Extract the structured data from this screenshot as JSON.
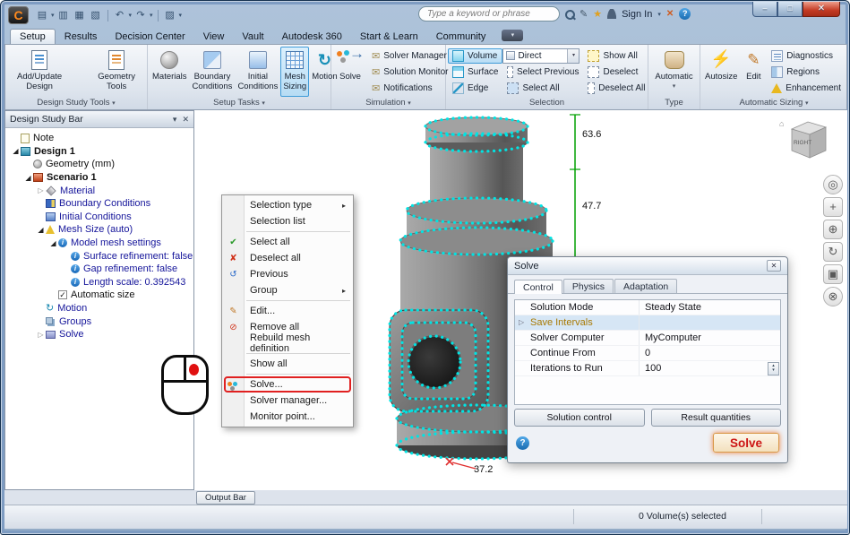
{
  "colors": {
    "accent_blue": "#3f9bd8",
    "selection_cyan": "#00e4e4",
    "solve_red": "#cc1414",
    "highlight_red": "#e02020",
    "dimension_green": "#00a000"
  },
  "titlebar": {
    "search_placeholder": "Type a keyword or phrase",
    "sign_in": "Sign In"
  },
  "tabs": [
    "Setup",
    "Results",
    "Decision Center",
    "View",
    "Vault",
    "Autodesk 360",
    "Start & Learn",
    "Community"
  ],
  "ribbon": {
    "group_labels": {
      "design_study_tools": "Design Study Tools",
      "setup_tasks": "Setup Tasks",
      "simulation": "Simulation",
      "selection": "Selection",
      "type": "Type",
      "automatic_sizing": "Automatic Sizing"
    },
    "buttons": {
      "add_update": [
        "Add/Update",
        "Design"
      ],
      "geometry_tools": [
        "Geometry",
        "Tools"
      ],
      "materials": "Materials",
      "boundary_conditions": [
        "Boundary",
        "Conditions"
      ],
      "initial_conditions": [
        "Initial",
        "Conditions"
      ],
      "mesh_sizing": [
        "Mesh",
        "Sizing"
      ],
      "motion": "Motion",
      "solve": "Solve",
      "solver_manager": "Solver Manager",
      "solution_monitor": "Solution Monitor",
      "notifications": "Notifications",
      "volume": "Volume",
      "surface": "Surface",
      "edge": "Edge",
      "direct": "Direct",
      "select_previous": "Select Previous",
      "select_all": "Select All",
      "show_all": "Show All",
      "deselect": "Deselect",
      "deselect_all": "Deselect All",
      "automatic": "Automatic",
      "autosize": "Autosize",
      "edit": "Edit",
      "diagnostics": "Diagnostics",
      "regions": "Regions",
      "enhancement": "Enhancement"
    }
  },
  "design_study_bar": {
    "title": "Design Study Bar",
    "tree": [
      "Note",
      "Design 1",
      "Geometry (mm)",
      "Scenario 1",
      "Material",
      "Boundary Conditions",
      "Initial Conditions",
      "Mesh Size (auto)",
      "Model mesh settings",
      "Surface refinement: false",
      "Gap refinement: false",
      "Length scale: 0.392543",
      "Automatic size",
      "Motion",
      "Groups",
      "Solve"
    ]
  },
  "context_menu": {
    "items": [
      "Selection type",
      "Selection list",
      "Select all",
      "Deselect all",
      "Previous",
      "Group",
      "Edit...",
      "Remove all",
      "Rebuild mesh definition",
      "Show all",
      "Solve...",
      "Solver manager...",
      "Monitor point..."
    ]
  },
  "solve_dialog": {
    "title": "Solve",
    "tabs": [
      "Control",
      "Physics",
      "Adaptation"
    ],
    "rows": [
      {
        "name": "Solution Mode",
        "value": "Steady State"
      },
      {
        "name": "Save Intervals",
        "value": ""
      },
      {
        "name": "Solver Computer",
        "value": "MyComputer"
      },
      {
        "name": "Continue From",
        "value": "0"
      },
      {
        "name": "Iterations to Run",
        "value": "100"
      }
    ],
    "solution_control": "Solution control",
    "result_quantities": "Result quantities",
    "solve_button": "Solve"
  },
  "viewport": {
    "dim_top": "63.6",
    "dim_mid": "47.7",
    "dim_bottom": "37.2",
    "viewcube_face": "RIGHT"
  },
  "bottom": {
    "output_bar": "Output Bar",
    "status": "0 Volume(s) selected"
  },
  "icons": {
    "logo": "C",
    "qat_new": "▤",
    "qat_open": "▥",
    "qat_save": "▦",
    "qat_save_all": "▧",
    "qat_undo": "↶",
    "qat_redo": "↷",
    "qat_print": "▨",
    "dropdown": "▾",
    "submenu": "▸",
    "pencil": "✎",
    "star": "★",
    "help": "?",
    "titlebar_close": "✕",
    "win_min": "–",
    "win_max": "□",
    "win_close": "✕",
    "tree_collapsed": "▷",
    "tree_expanded": "◢",
    "check": "✓",
    "info": "i",
    "envelope": "✉",
    "motion": "↻",
    "autosize": "⚡",
    "solve_arrow": "→",
    "menu_check": "✔",
    "menu_cross": "✘",
    "menu_undo": "↺",
    "menu_edit": "✎",
    "menu_remove": "⊘",
    "panel_pin": "▾",
    "panel_close": "✕",
    "viewcube_home": "⌂",
    "nav_wheel": "◎",
    "nav_pan": "+",
    "nav_zoom": "⊕",
    "nav_orbit": "↻",
    "nav_cam": "▣",
    "nav_close": "⊗",
    "spin_up": "▴",
    "spin_down": "▾",
    "dialog_close": "✕"
  }
}
